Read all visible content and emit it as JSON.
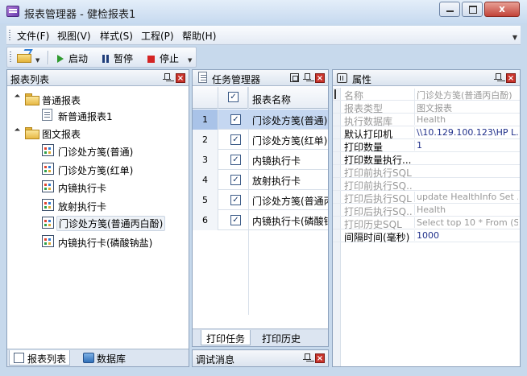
{
  "window": {
    "title": "报表管理器 - 健检报表1",
    "minimize_label": "",
    "maximize_label": "",
    "close_label": "x"
  },
  "menu": {
    "items": [
      "文件(F)",
      "视图(V)",
      "样式(S)",
      "工程(P)",
      "帮助(H)"
    ]
  },
  "toolbar": {
    "start_label": "启动",
    "pause_label": "暂停",
    "stop_label": "停止"
  },
  "report_list": {
    "title": "报表列表",
    "groups": [
      {
        "label": "普通报表",
        "items": [
          "新普通报表1"
        ]
      },
      {
        "label": "图文报表",
        "items": [
          "门诊处方笺(普通)",
          "门诊处方笺(红单)",
          "内镜执行卡",
          "放射执行卡",
          "门诊处方笺(普通丙白酚)",
          "内镜执行卡(磷酸钠盐)"
        ]
      }
    ],
    "selected_item": "门诊处方笺(普通丙白酚)",
    "tabs": [
      "报表列表",
      "数据库"
    ]
  },
  "task_manager": {
    "title": "任务管理器",
    "column_header": "报表名称",
    "rows": [
      {
        "num": "1",
        "checked": true,
        "name": "门诊处方笺(普通)"
      },
      {
        "num": "2",
        "checked": true,
        "name": "门诊处方笺(红单)"
      },
      {
        "num": "3",
        "checked": true,
        "name": "内镜执行卡"
      },
      {
        "num": "4",
        "checked": true,
        "name": "放射执行卡"
      },
      {
        "num": "5",
        "checked": true,
        "name": "门诊处方笺(普通丙白酚)"
      },
      {
        "num": "6",
        "checked": true,
        "name": "内镜执行卡(磷酸钠盐)"
      }
    ],
    "selected_row": "1",
    "tabs": [
      "打印任务",
      "打印历史"
    ]
  },
  "debug": {
    "title": "调试消息"
  },
  "properties": {
    "title": "属性",
    "rows": [
      {
        "key": "名称",
        "value": "门诊处方笺(普通丙白酚)",
        "active": false
      },
      {
        "key": "报表类型",
        "value": "图文报表",
        "active": false
      },
      {
        "key": "执行数据库",
        "value": "Health",
        "active": false
      },
      {
        "key": "默认打印机",
        "value": "\\\\10.129.100.123\\HP L...",
        "active": true
      },
      {
        "key": "打印数量",
        "value": "1",
        "active": true
      },
      {
        "key": "打印数量执行...",
        "value": "",
        "active": true
      },
      {
        "key": "打印前执行SQL",
        "value": "",
        "active": false
      },
      {
        "key": "打印前执行SQ...",
        "value": "",
        "active": false
      },
      {
        "key": "打印后执行SQL",
        "value": "update HealthInfo Set ...",
        "active": false
      },
      {
        "key": "打印后执行SQ...",
        "value": "Health",
        "active": false
      },
      {
        "key": "打印历史SQL",
        "value": "Select top 10 * From (S...",
        "active": false
      },
      {
        "key": "间隔时间(毫秒)",
        "value": "1000",
        "active": true
      }
    ]
  },
  "colors": {
    "selection": "#c5d7f1",
    "accent": "#1f2f8a",
    "close_red": "#c8332b"
  }
}
